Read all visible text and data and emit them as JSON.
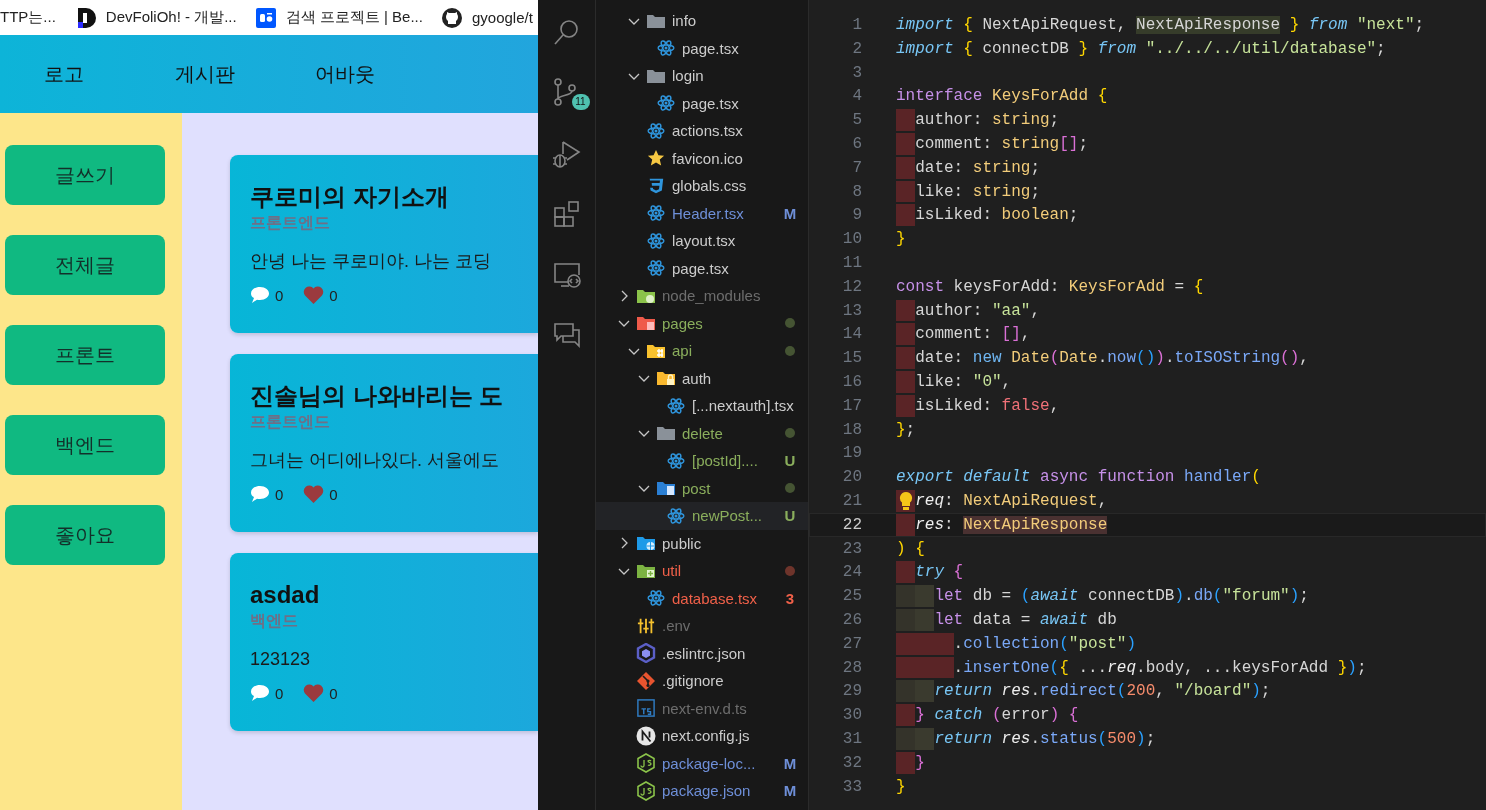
{
  "browser": {
    "bookmarks": [
      {
        "title": "TTP는...",
        "kind": "plain"
      },
      {
        "title": "DevFoliOh! - 개발...",
        "kind": "dlogo"
      },
      {
        "title": "검색 프로젝트 | Be...",
        "kind": "behance"
      },
      {
        "title": "gyoogle/t",
        "kind": "github"
      }
    ],
    "nav": [
      "로고",
      "게시판",
      "어바웃"
    ],
    "sidebar": [
      "글쓰기",
      "전체글",
      "프론트",
      "백엔드",
      "좋아요"
    ],
    "posts": [
      {
        "title": "쿠로미의 자기소개",
        "category": "프론트엔드",
        "excerpt": "안녕 나는 쿠로미야. 나는 코딩",
        "comments": "0",
        "likes": "0"
      },
      {
        "title": "진솔님의 나와바리는 도",
        "category": "프론트엔드",
        "excerpt": "그녀는 어디에나있다. 서울에도",
        "comments": "0",
        "likes": "0"
      },
      {
        "title": "asdad",
        "category": "백엔드",
        "excerpt": "123123",
        "comments": "0",
        "likes": "0"
      }
    ]
  },
  "activity_bar": {
    "source_control_badge": "11"
  },
  "explorer": {
    "scrolled_folder_items": [
      {
        "kind": "folder",
        "name": "info",
        "color": "#cccccc",
        "expanded": true,
        "dot": false,
        "selected": false,
        "children": [
          {
            "kind": "react",
            "name": "page.tsx",
            "color": "#cccccc",
            "selected": false
          }
        ]
      },
      {
        "kind": "folder",
        "name": "login",
        "color": "#cccccc",
        "expanded": true,
        "dot": false,
        "selected": false,
        "children": [
          {
            "kind": "react",
            "name": "page.tsx",
            "color": "#cccccc",
            "selected": false
          }
        ]
      },
      {
        "kind": "react",
        "name": "actions.tsx",
        "color": "#cccccc",
        "selected": false
      },
      {
        "kind": "star",
        "name": "favicon.ico",
        "color": "#cccccc",
        "selected": false
      },
      {
        "kind": "css",
        "name": "globals.css",
        "color": "#cccccc",
        "selected": false
      },
      {
        "kind": "react",
        "name": "Header.tsx",
        "color": "#6e8fd8",
        "badge": "M",
        "selected": false
      },
      {
        "kind": "react",
        "name": "layout.tsx",
        "color": "#cccccc",
        "selected": false
      },
      {
        "kind": "react",
        "name": "page.tsx",
        "color": "#cccccc",
        "selected": false
      }
    ],
    "items": [
      {
        "kind": "node",
        "name": "node_modules",
        "color": "#6d6d6d",
        "expanded": false,
        "dot": false,
        "selected": false
      },
      {
        "kind": "pages",
        "name": "pages",
        "color": "#8aae5c",
        "expanded": true,
        "dot": true,
        "selected": false,
        "children": [
          {
            "kind": "api",
            "name": "api",
            "color": "#8aae5c",
            "expanded": true,
            "dot": true,
            "selected": false,
            "children": [
              {
                "kind": "auth",
                "name": "auth",
                "color": "#cccccc",
                "expanded": true,
                "dot": false,
                "selected": false,
                "children": [
                  {
                    "kind": "react",
                    "name": "[...nextauth].tsx",
                    "color": "#cccccc",
                    "selected": false
                  }
                ]
              },
              {
                "kind": "folder",
                "name": "delete",
                "color": "#8aae5c",
                "expanded": true,
                "dot": true,
                "selected": false,
                "children": [
                  {
                    "kind": "react",
                    "name": "[postId]....",
                    "color": "#8aae5c",
                    "badge": "U",
                    "selected": false
                  }
                ]
              },
              {
                "kind": "post",
                "name": "post",
                "color": "#8aae5c",
                "expanded": true,
                "dot": true,
                "selected": false,
                "children": [
                  {
                    "kind": "react",
                    "name": "newPost...",
                    "color": "#8aae5c",
                    "badge": "U",
                    "selected": true
                  }
                ]
              }
            ]
          }
        ]
      },
      {
        "kind": "public",
        "name": "public",
        "color": "#cccccc",
        "expanded": false,
        "dot": false,
        "selected": false
      },
      {
        "kind": "util",
        "name": "util",
        "color": "#f06049",
        "expanded": true,
        "dot": true,
        "selected": false,
        "children": [
          {
            "kind": "react",
            "name": "database.tsx",
            "color": "#f06049",
            "badge": "3",
            "selected": false
          }
        ]
      },
      {
        "kind": "env",
        "name": ".env",
        "color": "#6d6d6d",
        "selected": false
      },
      {
        "kind": "eslint",
        "name": ".eslintrc.json",
        "color": "#cccccc",
        "selected": false
      },
      {
        "kind": "git",
        "name": ".gitignore",
        "color": "#cccccc",
        "selected": false
      },
      {
        "kind": "ts",
        "name": "next-env.d.ts",
        "color": "#6d6d6d",
        "selected": false
      },
      {
        "kind": "next",
        "name": "next.config.js",
        "color": "#cccccc",
        "selected": false
      },
      {
        "kind": "js",
        "name": "package-loc...",
        "color": "#6e8fd8",
        "badge": "M",
        "selected": false
      },
      {
        "kind": "js",
        "name": "package.json",
        "color": "#6e8fd8",
        "badge": "M",
        "selected": false
      }
    ]
  },
  "editor": {
    "lines": [
      {
        "number": "1",
        "selected": false,
        "tokens": [
          {
            "kind": "kwi",
            "text": "import"
          },
          {
            "kind": "b1",
            "text": " {"
          },
          {
            "kind": "plain",
            "text": " NextApiRequest, "
          },
          {
            "kind": "match",
            "text": "NextApiResponse"
          },
          {
            "kind": "b1",
            "text": " }"
          },
          {
            "kind": "kwi",
            "text": " from"
          },
          {
            "kind": "str",
            "text": " \"next\""
          },
          {
            "kind": "plain",
            "text": ";"
          }
        ]
      },
      {
        "number": "2",
        "selected": false,
        "tokens": [
          {
            "kind": "kwi",
            "text": "import"
          },
          {
            "kind": "b1",
            "text": " {"
          },
          {
            "kind": "plain",
            "text": " connectDB "
          },
          {
            "kind": "b1",
            "text": "}"
          },
          {
            "kind": "kwi",
            "text": " from"
          },
          {
            "kind": "str",
            "text": " \"../../../util/database\""
          },
          {
            "kind": "plain",
            "text": ";"
          }
        ]
      },
      {
        "number": "3",
        "selected": false
      },
      {
        "number": "4",
        "selected": false,
        "tokens": [
          {
            "kind": "storage",
            "text": "interface"
          },
          {
            "kind": "type",
            "text": " KeysForAdd"
          },
          {
            "kind": "b1",
            "text": " {"
          }
        ]
      },
      {
        "number": "5",
        "indent": [
          {
            "error": true
          }
        ],
        "selected": false,
        "tokens": [
          {
            "kind": "plain",
            "text": "author: "
          },
          {
            "kind": "type",
            "text": "string"
          },
          {
            "kind": "plain",
            "text": ";"
          }
        ]
      },
      {
        "number": "6",
        "indent": [
          {
            "error": true
          }
        ],
        "selected": false,
        "tokens": [
          {
            "kind": "plain",
            "text": "comment: "
          },
          {
            "kind": "type",
            "text": "string"
          },
          {
            "kind": "b2",
            "text": "[]"
          },
          {
            "kind": "plain",
            "text": ";"
          }
        ]
      },
      {
        "number": "7",
        "indent": [
          {
            "error": true
          }
        ],
        "selected": false,
        "tokens": [
          {
            "kind": "plain",
            "text": "date: "
          },
          {
            "kind": "type",
            "text": "string"
          },
          {
            "kind": "plain",
            "text": ";"
          }
        ]
      },
      {
        "number": "8",
        "indent": [
          {
            "error": true
          }
        ],
        "selected": false,
        "tokens": [
          {
            "kind": "plain",
            "text": "like: "
          },
          {
            "kind": "type",
            "text": "string"
          },
          {
            "kind": "plain",
            "text": ";"
          }
        ]
      },
      {
        "number": "9",
        "indent": [
          {
            "error": true
          }
        ],
        "selected": false,
        "tokens": [
          {
            "kind": "plain",
            "text": "isLiked: "
          },
          {
            "kind": "type",
            "text": "boolean"
          },
          {
            "kind": "plain",
            "text": ";"
          }
        ]
      },
      {
        "number": "10",
        "selected": false,
        "tokens": [
          {
            "kind": "b1",
            "text": "}"
          }
        ]
      },
      {
        "number": "11",
        "selected": false
      },
      {
        "number": "12",
        "selected": false,
        "tokens": [
          {
            "kind": "storage",
            "text": "const"
          },
          {
            "kind": "plain",
            "text": " keysForAdd: "
          },
          {
            "kind": "type",
            "text": "KeysForAdd"
          },
          {
            "kind": "plain",
            "text": " = "
          },
          {
            "kind": "b1",
            "text": "{"
          }
        ]
      },
      {
        "number": "13",
        "indent": [
          {
            "error": true
          }
        ],
        "selected": false,
        "tokens": [
          {
            "kind": "plain",
            "text": "author: "
          },
          {
            "kind": "str",
            "text": "\"aa\""
          },
          {
            "kind": "plain",
            "text": ","
          }
        ]
      },
      {
        "number": "14",
        "indent": [
          {
            "error": true
          }
        ],
        "selected": false,
        "tokens": [
          {
            "kind": "plain",
            "text": "comment: "
          },
          {
            "kind": "b2",
            "text": "[]"
          },
          {
            "kind": "plain",
            "text": ","
          }
        ]
      },
      {
        "number": "15",
        "indent": [
          {
            "error": true
          }
        ],
        "selected": false,
        "tokens": [
          {
            "kind": "plain",
            "text": "date: "
          },
          {
            "kind": "kw",
            "text": "new"
          },
          {
            "kind": "type",
            "text": " Date"
          },
          {
            "kind": "b2",
            "text": "("
          },
          {
            "kind": "type",
            "text": "Date"
          },
          {
            "kind": "plain",
            "text": "."
          },
          {
            "kind": "fn",
            "text": "now"
          },
          {
            "kind": "b3",
            "text": "()"
          },
          {
            "kind": "b2",
            "text": ")"
          },
          {
            "kind": "plain",
            "text": "."
          },
          {
            "kind": "fn",
            "text": "toISOString"
          },
          {
            "kind": "b2",
            "text": "()"
          },
          {
            "kind": "plain",
            "text": ","
          }
        ]
      },
      {
        "number": "16",
        "indent": [
          {
            "error": true
          }
        ],
        "selected": false,
        "tokens": [
          {
            "kind": "plain",
            "text": "like: "
          },
          {
            "kind": "str",
            "text": "\"0\""
          },
          {
            "kind": "plain",
            "text": ","
          }
        ]
      },
      {
        "number": "17",
        "indent": [
          {
            "error": true
          }
        ],
        "selected": false,
        "tokens": [
          {
            "kind": "plain",
            "text": "isLiked: "
          },
          {
            "kind": "lit",
            "text": "false"
          },
          {
            "kind": "plain",
            "text": ","
          }
        ]
      },
      {
        "number": "18",
        "selected": false,
        "tokens": [
          {
            "kind": "b1",
            "text": "}"
          },
          {
            "kind": "plain",
            "text": ";"
          }
        ]
      },
      {
        "number": "19",
        "selected": false
      },
      {
        "number": "20",
        "selected": false,
        "tokens": [
          {
            "kind": "kwi",
            "text": "export"
          },
          {
            "kind": "kwi",
            "text": " default"
          },
          {
            "kind": "storage",
            "text": " async"
          },
          {
            "kind": "storage",
            "text": " function"
          },
          {
            "kind": "fn",
            "text": " handler"
          },
          {
            "kind": "b1",
            "text": "("
          }
        ]
      },
      {
        "number": "21",
        "indent": [
          {
            "error": true
          }
        ],
        "lightbulb": true,
        "selected": false,
        "tokens": [
          {
            "kind": "vi",
            "text": "req"
          },
          {
            "kind": "plain",
            "text": ": "
          },
          {
            "kind": "type",
            "text": "NextApiRequest"
          },
          {
            "kind": "plain",
            "text": ","
          }
        ]
      },
      {
        "number": "22",
        "indent": [
          {
            "error": true
          }
        ],
        "selected": true,
        "tokens": [
          {
            "kind": "vi",
            "text": "res"
          },
          {
            "kind": "plain",
            "text": ": "
          },
          {
            "kind": "typematch",
            "text": "NextApiResponse"
          }
        ]
      },
      {
        "number": "23",
        "selected": false,
        "tokens": [
          {
            "kind": "b1",
            "text": ")"
          },
          {
            "kind": "b1",
            "text": " {"
          }
        ]
      },
      {
        "number": "24",
        "indent": [
          {
            "error": true
          }
        ],
        "selected": false,
        "tokens": [
          {
            "kind": "kwi",
            "text": "try"
          },
          {
            "kind": "b2",
            "text": " {"
          }
        ]
      },
      {
        "number": "25",
        "indent": [
          {
            "error": false
          },
          {
            "error": false
          }
        ],
        "selected": false,
        "tokens": [
          {
            "kind": "storage",
            "text": "let"
          },
          {
            "kind": "plain",
            "text": " db = "
          },
          {
            "kind": "b3",
            "text": "("
          },
          {
            "kind": "kwi",
            "text": "await"
          },
          {
            "kind": "plain",
            "text": " connectDB"
          },
          {
            "kind": "b3",
            "text": ")"
          },
          {
            "kind": "plain",
            "text": "."
          },
          {
            "kind": "fn",
            "text": "db"
          },
          {
            "kind": "b3",
            "text": "("
          },
          {
            "kind": "str",
            "text": "\"forum\""
          },
          {
            "kind": "b3",
            "text": ")"
          },
          {
            "kind": "plain",
            "text": ";"
          }
        ]
      },
      {
        "number": "26",
        "indent": [
          {
            "error": false
          },
          {
            "error": false
          }
        ],
        "selected": false,
        "tokens": [
          {
            "kind": "storage",
            "text": "let"
          },
          {
            "kind": "plain",
            "text": " data = "
          },
          {
            "kind": "kwi",
            "text": "await"
          },
          {
            "kind": "plain",
            "text": " db"
          }
        ]
      },
      {
        "number": "27",
        "indent": [
          {
            "error": true
          },
          {
            "error": true
          },
          {
            "error": true
          }
        ],
        "selected": false,
        "tokens": [
          {
            "kind": "plain",
            "text": "."
          },
          {
            "kind": "fn",
            "text": "collection"
          },
          {
            "kind": "b3",
            "text": "("
          },
          {
            "kind": "str",
            "text": "\"post\""
          },
          {
            "kind": "b3",
            "text": ")"
          }
        ]
      },
      {
        "number": "28",
        "indent": [
          {
            "error": true
          },
          {
            "error": true
          },
          {
            "error": true
          }
        ],
        "selected": false,
        "tokens": [
          {
            "kind": "plain",
            "text": "."
          },
          {
            "kind": "fn",
            "text": "insertOne"
          },
          {
            "kind": "b3",
            "text": "("
          },
          {
            "kind": "b1",
            "text": "{"
          },
          {
            "kind": "plain",
            "text": " ..."
          },
          {
            "kind": "vi",
            "text": "req"
          },
          {
            "kind": "plain",
            "text": ".body, ...keysForAdd "
          },
          {
            "kind": "b1",
            "text": "}"
          },
          {
            "kind": "b3",
            "text": ")"
          },
          {
            "kind": "plain",
            "text": ";"
          }
        ]
      },
      {
        "number": "29",
        "indent": [
          {
            "error": false
          },
          {
            "error": false
          }
        ],
        "selected": false,
        "tokens": [
          {
            "kind": "kwi",
            "text": "return"
          },
          {
            "kind": "vi",
            "text": " res"
          },
          {
            "kind": "plain",
            "text": "."
          },
          {
            "kind": "fn",
            "text": "redirect"
          },
          {
            "kind": "b3",
            "text": "("
          },
          {
            "kind": "num",
            "text": "200"
          },
          {
            "kind": "plain",
            "text": ", "
          },
          {
            "kind": "str",
            "text": "\"/board\""
          },
          {
            "kind": "b3",
            "text": ")"
          },
          {
            "kind": "plain",
            "text": ";"
          }
        ]
      },
      {
        "number": "30",
        "indent": [
          {
            "error": true
          }
        ],
        "selected": false,
        "tokens": [
          {
            "kind": "b2",
            "text": "}"
          },
          {
            "kind": "kwi",
            "text": " catch"
          },
          {
            "kind": "b2",
            "text": " ("
          },
          {
            "kind": "plain",
            "text": "error"
          },
          {
            "kind": "b2",
            "text": ")"
          },
          {
            "kind": "b2",
            "text": " {"
          }
        ]
      },
      {
        "number": "31",
        "indent": [
          {
            "error": false
          },
          {
            "error": false
          }
        ],
        "selected": false,
        "tokens": [
          {
            "kind": "kwi",
            "text": "return"
          },
          {
            "kind": "vi",
            "text": " res"
          },
          {
            "kind": "plain",
            "text": "."
          },
          {
            "kind": "fn",
            "text": "status"
          },
          {
            "kind": "b3",
            "text": "("
          },
          {
            "kind": "num",
            "text": "500"
          },
          {
            "kind": "b3",
            "text": ")"
          },
          {
            "kind": "plain",
            "text": ";"
          }
        ]
      },
      {
        "number": "32",
        "indent": [
          {
            "error": true
          }
        ],
        "selected": false,
        "tokens": [
          {
            "kind": "b2",
            "text": "}"
          }
        ]
      },
      {
        "number": "33",
        "selected": false,
        "tokens": [
          {
            "kind": "b1",
            "text": "}"
          }
        ]
      }
    ]
  }
}
